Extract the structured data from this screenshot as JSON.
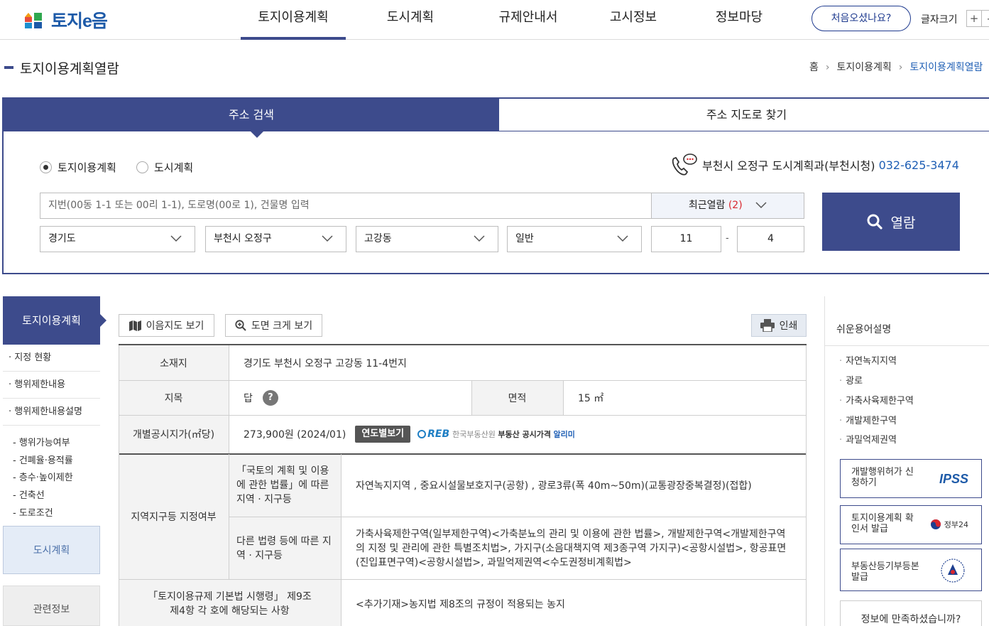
{
  "header": {
    "logo_text": "토지e음",
    "nav": [
      "토지이용계획",
      "도시계획",
      "규제안내서",
      "고시정보",
      "정보마당"
    ],
    "first_visit_label": "처음오셨나요?",
    "font_size_label": "글자크기",
    "font_plus": "+",
    "font_minus": "-"
  },
  "page": {
    "title": "토지이용계획열람",
    "breadcrumb": [
      "홈",
      "토지이용계획",
      "토지이용계획열람"
    ]
  },
  "search": {
    "tab_address": "주소 검색",
    "tab_map": "주소 지도로 찾기",
    "radio_land": "토지이용계획",
    "radio_city": "도시계획",
    "contact_text": "부천시 오정구 도시계획과(부천시청)",
    "contact_phone": "032-625-3474",
    "input_placeholder": "지번(00동 1-1 또는 00리 1-1), 도로명(00로 1), 건물명 입력",
    "recent_label": "최근열람",
    "recent_count": "(2)",
    "sido": "경기도",
    "sigungu": "부천시 오정구",
    "dong": "고강동",
    "land_type": "일반",
    "bonbun": "11",
    "dash": "-",
    "bubun": "4",
    "view_button": "열람"
  },
  "left_nav": {
    "header": "토지이용계획",
    "items": [
      "지정 현황",
      "행위제한내용",
      "행위제한내용설명"
    ],
    "sub_items": [
      "- 행위가능여부",
      "- 건폐율·용적률",
      "- 층수·높이제한",
      "- 건축선",
      "- 도로조건"
    ],
    "city_plan": "도시계획",
    "related_info": "관련정보"
  },
  "toolbar": {
    "map_view": "이음지도 보기",
    "zoom_view": "도면 크게 보기",
    "print": "인쇄"
  },
  "table": {
    "location_label": "소재지",
    "location_value": "경기도 부천시 오정구 고강동 11-4번지",
    "jimok_label": "지목",
    "jimok_value": "답",
    "help_mark": "?",
    "area_label": "면적",
    "area_value": "15 ㎡",
    "price_label": "개별공시지가(㎡당)",
    "price_value": "273,900원 (2024/01)",
    "year_button": "연도별보기",
    "reb_logo": "REB",
    "reb_name": "한국부동산원",
    "reb_service": "부동산 공시가격",
    "reb_alimi": "알리미",
    "zone_label": "지역지구등 지정여부",
    "national_law_label": "「국토의 계획 및 이용에 관한 법률」에 따른 지역 · 지구등",
    "national_law_value": "자연녹지지역 , 중요시설물보호지구(공항) , 광로3류(폭 40m~50m)(교통광장중복결정)(접합)",
    "other_law_label": "다른 법령 등에 따른 지역 · 지구등",
    "other_law_value": "가축사육제한구역(일부제한구역)<가축분뇨의 관리 및 이용에 관한 법률>, 개발제한구역<개발제한구역의 지정 및 관리에 관한 특별조치법>, 가지구(소음대책지역 제3종구역 가지구)<공항시설법>, 항공표면(진입표면구역)<공항시설법>, 과밀억제권역<수도권정비계획법>",
    "decree_label": "「토지이용규제 기본법 시행령」 제9조 제4항 각 호에 해당되는 사항",
    "decree_value": "<추가기재>농지법 제8조의 규정이 적용되는 농지"
  },
  "right_panel": {
    "title": "쉬운용어설명",
    "terms": [
      "자연녹지지역",
      "광로",
      "가축사육제한구역",
      "개발제한구역",
      "과밀억제권역"
    ],
    "box1": "개발행위허가 신청하기",
    "box1_logo": "IPSS",
    "box2": "토지이용계획 확인서 발급",
    "box2_logo": "정부24",
    "box3": "부동산등기부등본 발급",
    "satisfaction": "정보에 만족하셨습니까?"
  },
  "colors": {
    "primary": "#3d4b8c",
    "link": "#1f5fb5",
    "accent_red": "#d9262d"
  }
}
